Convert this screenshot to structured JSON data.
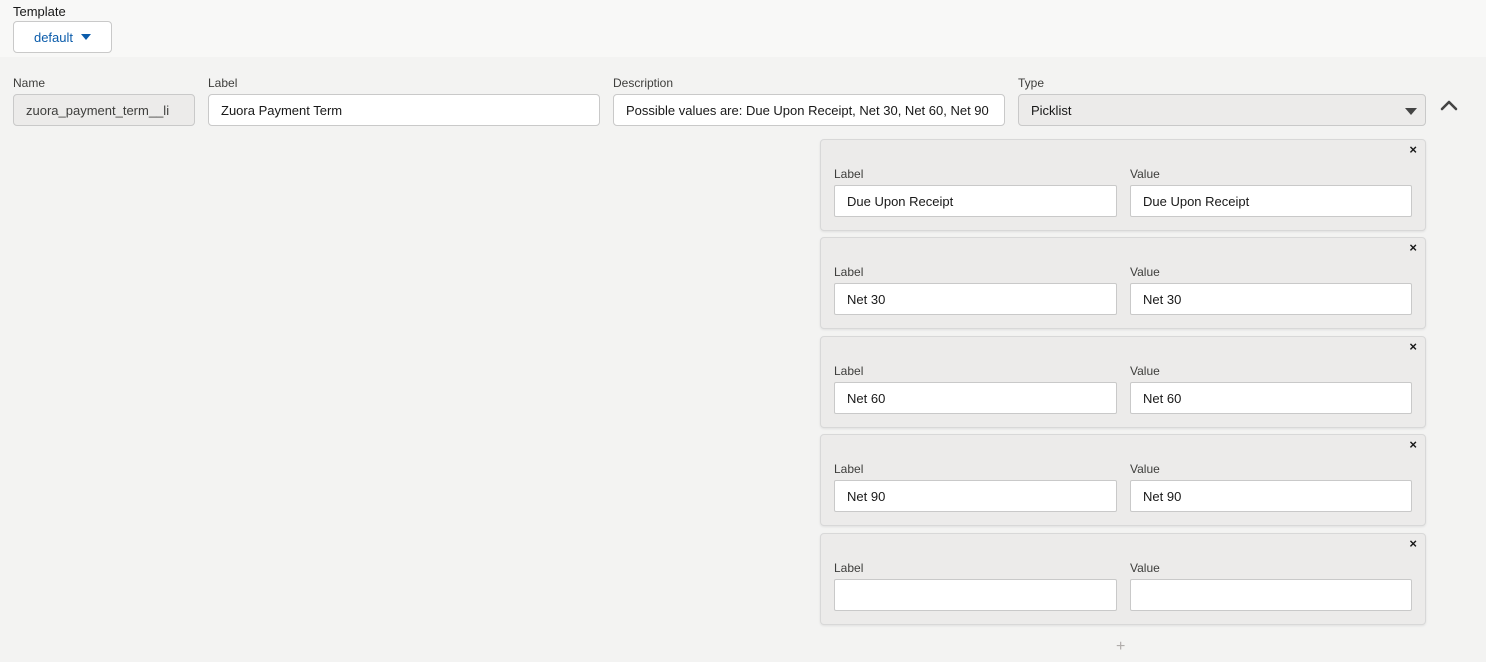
{
  "template": {
    "title": "Template",
    "selected": "default"
  },
  "fields": {
    "name_label": "Name",
    "name_value": "zuora_payment_term__li",
    "label_label": "Label",
    "label_value": "Zuora Payment Term",
    "description_label": "Description",
    "description_value": "Possible values are: Due Upon Receipt, Net 30, Net 60, Net 90",
    "type_label": "Type",
    "type_value": "Picklist"
  },
  "picklist": {
    "label_header": "Label",
    "value_header": "Value",
    "close_glyph": "×",
    "add_glyph": "+",
    "items": [
      {
        "label": "Due Upon Receipt",
        "value": "Due Upon Receipt"
      },
      {
        "label": "Net 30",
        "value": "Net 30"
      },
      {
        "label": "Net 60",
        "value": "Net 60"
      },
      {
        "label": "Net 90",
        "value": "Net 90"
      },
      {
        "label": "",
        "value": ""
      }
    ]
  },
  "icons": {
    "template_dropdown": "triangle-down-icon",
    "type_dropdown": "triangle-down-icon",
    "collapse": "chevron-up-icon",
    "remove": "close-icon",
    "add": "plus-icon"
  }
}
